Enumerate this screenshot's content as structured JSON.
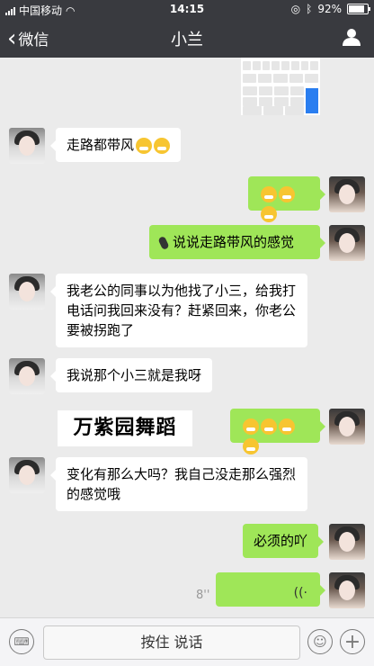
{
  "status": {
    "carrier": "中国移动",
    "time": "14:15",
    "battery": "92%",
    "battery_level": 0.92
  },
  "nav": {
    "back_label": "微信",
    "title": "小兰"
  },
  "messages": {
    "m1": "走路都带风",
    "m3": "说说走路带风的感觉",
    "m4": "我老公的同事以为他找了小三，给我打电话问我回来没有？赶紧回来，你老公要被拐跑了",
    "m5": "我说那个小三就是我呀",
    "m7": "变化有那么大吗？我自己没走那么强烈的感觉哦",
    "m8": "必须的吖"
  },
  "caption": "万紫园舞蹈",
  "voice": {
    "duration": "8''"
  },
  "input": {
    "hold_label": "按住 说话"
  },
  "colors": {
    "top_bar": "#393a3f",
    "out_bubble": "#9fe658",
    "in_bubble": "#ffffff",
    "background": "#ebebeb"
  }
}
